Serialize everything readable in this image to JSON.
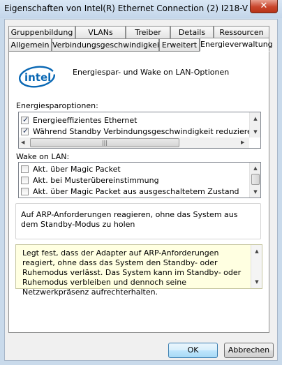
{
  "window": {
    "title": "Eigenschaften von Intel(R) Ethernet Connection (2) I218-V",
    "close_glyph": "✕"
  },
  "tabs_row1": [
    "Gruppenbildung",
    "VLANs",
    "Treiber",
    "Details",
    "Ressourcen"
  ],
  "tabs_row2": [
    "Allgemein",
    "Verbindungsgeschwindigkeit",
    "Erweitert",
    "Energieverwaltung"
  ],
  "active_tab": "Energieverwaltung",
  "header": {
    "logo_text": "intel",
    "text": "Energiespar- und Wake on LAN-Optionen"
  },
  "energy_section": {
    "label": "Energiesparoptionen:",
    "items": [
      {
        "label": "Energieeffizientes Ethernet",
        "checked": true
      },
      {
        "label": "Während Standby Verbindungsgeschwindigkeit reduzieren",
        "checked": true
      }
    ],
    "hscroll_thumb_glyph": "|||"
  },
  "wol_section": {
    "label": "Wake on LAN:",
    "items": [
      {
        "label": "Akt. über Magic Packet",
        "checked": false
      },
      {
        "label": "Akt. bei Musterübereinstimmung",
        "checked": false
      },
      {
        "label": "Akt. über Magic Packet aus ausgeschaltetem Zustand",
        "checked": false
      }
    ]
  },
  "description": "Auf ARP-Anforderungen reagieren, ohne das System aus dem Standby-Modus zu holen",
  "help_text": "Legt fest, dass der Adapter auf ARP-Anforderungen reagiert, ohne dass das System den Standby- oder Ruhemodus verlässt. Das System kann im Standby- oder Ruhemodus verbleiben und dennoch seine Netzwerkpräsenz aufrechterhalten.",
  "buttons": {
    "ok": "OK",
    "cancel": "Abbrechen"
  },
  "colors": {
    "intel_blue": "#0a68b4",
    "help_bg": "#ffffe1"
  }
}
